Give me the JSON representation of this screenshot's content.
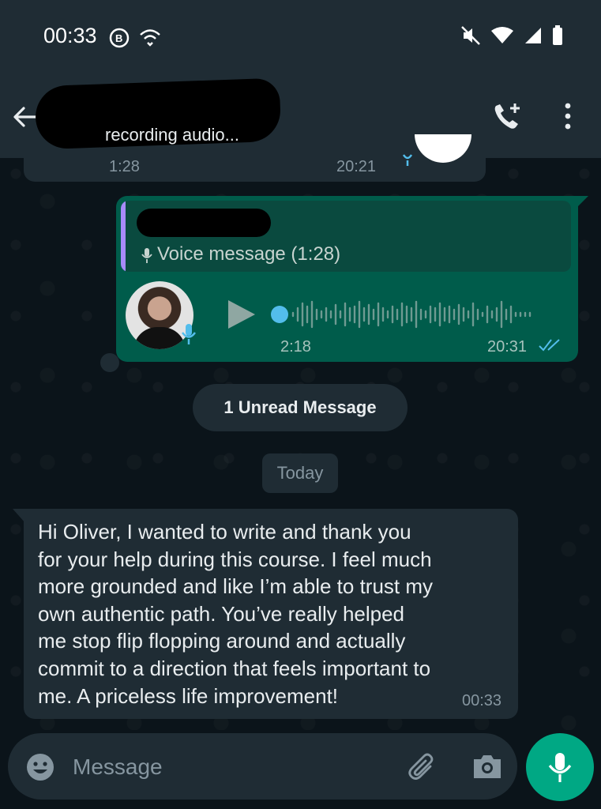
{
  "status_bar": {
    "time": "00:33"
  },
  "header": {
    "subtitle": "recording audio..."
  },
  "previous_message": {
    "duration": "1:28",
    "time": "20:21"
  },
  "voice_message": {
    "quote_label": "Voice message (1:28)",
    "duration": "2:18",
    "time": "20:31",
    "status": "read"
  },
  "unread_divider": "1 Unread Message",
  "date_divider": "Today",
  "incoming_message": {
    "lines": [
      "Hi Oliver, I wanted to write and thank you",
      "for your help during this course. I feel much",
      "more grounded and like I’m able to trust my",
      "own authentic path. You’ve really helped",
      "me stop flip flopping around and actually",
      "commit to a direction that feels important to",
      "me. A priceless life improvement!"
    ],
    "time": "00:33"
  },
  "composer": {
    "placeholder": "Message"
  },
  "colors": {
    "header_bg": "#1f2c34",
    "outgoing_bubble": "#005c4b",
    "incoming_bubble": "#1f2c34",
    "accent_green": "#00a884",
    "read_tick_blue": "#53bdeb",
    "quote_bar": "#a78bfa"
  },
  "icons": [
    "back-arrow-icon",
    "add-call-icon",
    "more-vert-icon",
    "mic-icon",
    "play-icon",
    "double-check-icon",
    "emoji-icon",
    "attach-icon",
    "camera-icon",
    "wifi-icon",
    "signal-icon",
    "battery-icon",
    "mute-icon"
  ]
}
